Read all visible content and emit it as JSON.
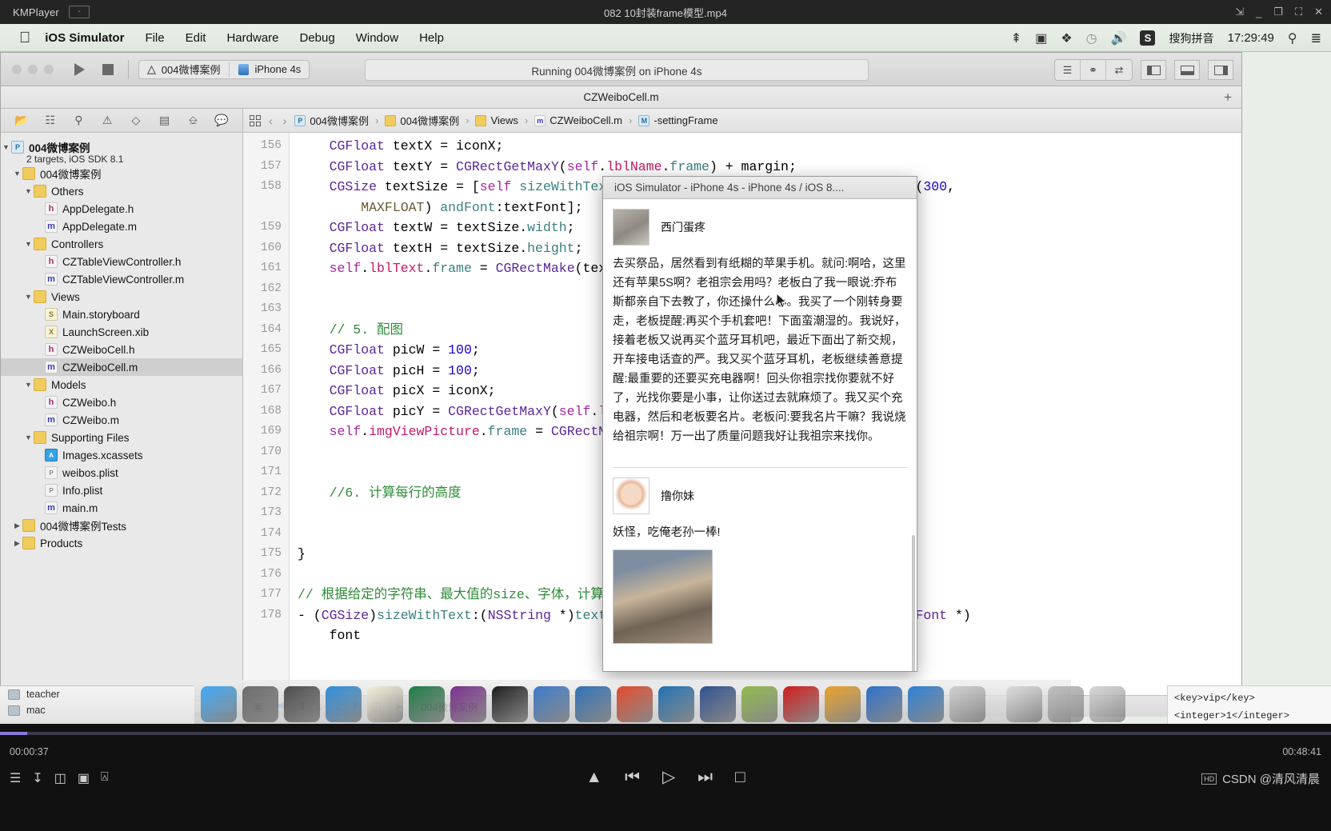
{
  "player": {
    "app_name": "KMPlayer",
    "minimize_label": "-",
    "video_title": "082 10封装frame模型.mp4",
    "window_buttons": [
      "pin-icon",
      "minimize-icon",
      "maximize-icon",
      "fullscreen-icon",
      "close-icon"
    ],
    "current_time": "00:00:37",
    "total_time": "00:48:41",
    "controls": [
      "eject-icon",
      "previous-icon",
      "play-icon",
      "next-icon",
      "stop-icon"
    ],
    "left_controls": [
      "playlist-icon",
      "download-icon",
      "subtitle-icon",
      "threed-icon",
      "capture-icon"
    ],
    "watermark": "CSDN @清风清晨",
    "watermark_badge": "HD"
  },
  "macmenu": {
    "apple": "apple-icon",
    "items": [
      "iOS Simulator",
      "File",
      "Edit",
      "Hardware",
      "Debug",
      "Window",
      "Help"
    ],
    "status_icons": [
      "bluetooth-icon",
      "screen-record-icon",
      "airdrop-icon",
      "timemachine-icon",
      "volume-icon"
    ],
    "input_badge": "S",
    "input_method": "搜狗拼音",
    "clock": "17:29:49",
    "spotlight": "search-icon",
    "notification": "notification-center-icon"
  },
  "xcode": {
    "window_title": "CZWeiboCell.m",
    "scheme": "004微博案例",
    "destination": "iPhone 4s",
    "activity_status": "Running 004微博案例 on iPhone 4s",
    "nav_tabs": [
      "folder-icon",
      "source-control-icon",
      "search-icon",
      "warning-icon",
      "test-icon",
      "debug-icon",
      "breakpoint-icon",
      "report-icon"
    ],
    "jumpbar": {
      "back": "‹",
      "forward": "›",
      "crumbs": [
        {
          "label": "004微博案例",
          "icon": "project-icon"
        },
        {
          "label": "004微博案例",
          "icon": "folder-icon"
        },
        {
          "label": "Views",
          "icon": "folder-icon"
        },
        {
          "label": "CZWeiboCell.m",
          "icon": "m-file-icon"
        },
        {
          "label": "-settingFrame",
          "icon": "method-icon"
        }
      ]
    },
    "navigator": {
      "project_name": "004微博案例",
      "project_sub": "2 targets, iOS SDK 8.1",
      "items": [
        {
          "label": "004微博案例",
          "icon": "folder-icon",
          "indent": 1,
          "twisty": "▼"
        },
        {
          "label": "Others",
          "icon": "folder-icon",
          "indent": 2,
          "twisty": "▼"
        },
        {
          "label": "AppDelegate.h",
          "icon": "h",
          "indent": 3,
          "twisty": ""
        },
        {
          "label": "AppDelegate.m",
          "icon": "m",
          "indent": 3,
          "twisty": ""
        },
        {
          "label": "Controllers",
          "icon": "folder-icon",
          "indent": 2,
          "twisty": "▼"
        },
        {
          "label": "CZTableViewController.h",
          "icon": "h",
          "indent": 3,
          "twisty": ""
        },
        {
          "label": "CZTableViewController.m",
          "icon": "m",
          "indent": 3,
          "twisty": ""
        },
        {
          "label": "Views",
          "icon": "folder-icon",
          "indent": 2,
          "twisty": "▼"
        },
        {
          "label": "Main.storyboard",
          "icon": "sb",
          "indent": 3,
          "twisty": ""
        },
        {
          "label": "LaunchScreen.xib",
          "icon": "xib",
          "indent": 3,
          "twisty": ""
        },
        {
          "label": "CZWeiboCell.h",
          "icon": "h",
          "indent": 3,
          "twisty": ""
        },
        {
          "label": "CZWeiboCell.m",
          "icon": "m",
          "indent": 3,
          "twisty": "",
          "selected": true
        },
        {
          "label": "Models",
          "icon": "folder-icon",
          "indent": 2,
          "twisty": "▼"
        },
        {
          "label": "CZWeibo.h",
          "icon": "h",
          "indent": 3,
          "twisty": ""
        },
        {
          "label": "CZWeibo.m",
          "icon": "m",
          "indent": 3,
          "twisty": ""
        },
        {
          "label": "Supporting Files",
          "icon": "folder-icon",
          "indent": 2,
          "twisty": "▼"
        },
        {
          "label": "Images.xcassets",
          "icon": "xcassets",
          "indent": 3,
          "twisty": ""
        },
        {
          "label": "weibos.plist",
          "icon": "plist",
          "indent": 3,
          "twisty": ""
        },
        {
          "label": "Info.plist",
          "icon": "plist",
          "indent": 3,
          "twisty": ""
        },
        {
          "label": "main.m",
          "icon": "m",
          "indent": 3,
          "twisty": ""
        },
        {
          "label": "004微博案例Tests",
          "icon": "folder-icon",
          "indent": 1,
          "twisty": "▶"
        },
        {
          "label": "Products",
          "icon": "folder-icon",
          "indent": 1,
          "twisty": "▶"
        }
      ],
      "filter_icons": [
        "add-icon",
        "recent-icon",
        "modified-icon",
        "source-control-filter-icon"
      ]
    },
    "code": {
      "first_line": 156,
      "lines": [
        "    CGFloat textX = iconX;",
        "    CGFloat textY = CGRectGetMaxY(self.lblName.frame) + margin;",
        "    CGSize textSize = [self sizeWithText:self.weibo.text andMaxSize:CGSizeMake(300,",
        "        MAXFLOAT) andFont:textFont];",
        "    CGFloat textW = textSize.width;",
        "    CGFloat textH = textSize.height;",
        "    self.lblText.frame = CGRectMake(textX, textY, textW, textH);",
        "",
        "",
        "    // 5. 配图",
        "    CGFloat picW = 100;",
        "    CGFloat picH = 100;",
        "    CGFloat picX = iconX;",
        "    CGFloat picY = CGRectGetMaxY(self.lblText.frame) + margin;",
        "    self.imgViewPicture.frame = CGRectMake(picX, picY, picW, picH);",
        "",
        "",
        "    //6. 计算每行的高度",
        "",
        "",
        "}",
        "",
        "// 根据给定的字符串、最大值的size、字体，计算出字符串的大小",
        "- (CGSize)sizeWithText:(NSString *)text andMaxSize:(CGSize)maxSize andFont:(UIFont *)",
        "    font"
      ],
      "visible_numbers": [
        156,
        157,
        158,
        "",
        159,
        160,
        161,
        162,
        163,
        164,
        165,
        166,
        167,
        168,
        169,
        170,
        171,
        172,
        173,
        174,
        175,
        176,
        177,
        178,
        ""
      ]
    },
    "editor_status": {
      "target": "004微博案例",
      "icons": [
        "assistant-icon",
        "breakpoint-icon",
        "step-icon",
        "step-over-icon",
        "step-into-icon",
        "step-out-icon",
        "simulate-icon",
        "location-icon"
      ]
    },
    "toolbar_right": {
      "view_buttons": [
        "standard-editor-icon",
        "assistant-editor-icon",
        "version-editor-icon"
      ],
      "panel_buttons": [
        "navigator-toggle-icon",
        "debug-area-toggle-icon",
        "utilities-toggle-icon"
      ]
    }
  },
  "simulator": {
    "title": "iOS Simulator - iPhone 4s - iPhone 4s / iOS 8....",
    "cells": [
      {
        "nick": "西门蛋疼",
        "avatar": "avatar-ximen",
        "text": "去买祭品，居然看到有纸糊的苹果手机。就问:啊哈，这里还有苹果5S啊？老祖宗会用吗？老板白了我一眼说:乔布斯都亲自下去教了，你还操什么心。我买了一个刚转身要走，老板提醒:再买个手机套吧！下面蛮潮湿的。我说好，接着老板又说再买个蓝牙耳机吧，最近下面出了新交规，开车接电话查的严。我又买个蓝牙耳机，老板继续善意提醒:最重要的还要买充电器啊！回头你祖宗找你要就不好了，光找你要是小事，让你送过去就麻烦了。我又买个充电器，然后和老板要名片。老板问:要我名片干嘛？我说烧给祖宗啊！万一出了质量问题我好让我祖宗来找你。",
        "picture": false
      },
      {
        "nick": "撸你妹",
        "avatar": "avatar-lunimei",
        "text": "妖怪，吃俺老孙一棒!",
        "picture": true
      }
    ]
  },
  "desktop": {
    "finder_items": [
      "teacher",
      "mac"
    ],
    "dock_apps": [
      "finder-icon",
      "system-preferences-icon",
      "launchpad-icon",
      "safari-icon",
      "notes-icon",
      "excel-icon",
      "onenote-icon",
      "terminal-icon",
      "xcode-icon",
      "simulator-icon",
      "help-icon",
      "snip-icon",
      "quicktime-icon",
      "preview-icon",
      "filezilla-icon",
      "sketch-icon",
      "word-icon",
      "appstore-icon",
      "xcode-beta-icon",
      "printer-icon",
      "airdrop-icon",
      "trash-icon"
    ],
    "plist_snippet_1": "<key>vip</key>",
    "plist_snippet_2": "<integer>1</integer>"
  }
}
